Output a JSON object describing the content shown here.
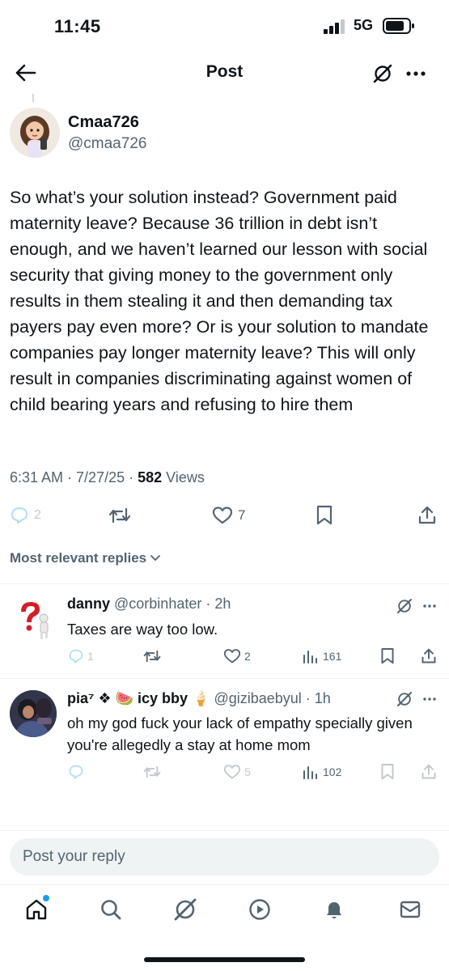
{
  "status_bar": {
    "time": "11:45",
    "network": "5G"
  },
  "header": {
    "title": "Post"
  },
  "post": {
    "author_name": "Cmaa726",
    "author_handle": "@cmaa726",
    "text": "So what’s your solution instead? Government paid maternity leave? Because 36 trillion in debt isn’t enough, and we haven’t learned our lesson with social security that giving money to the government only results in them stealing it and then demanding tax payers pay even more? Or is your solution to mandate companies pay longer maternity leave? This will only result in companies discriminating against women of child bearing years and refusing to hire them",
    "timestamp": "6:31 AM · 7/27/25 · ",
    "views_count": "582",
    "views_label": " Views",
    "reply_count": "2",
    "like_count": "7"
  },
  "replies_sort_label": "Most relevant replies",
  "replies": [
    {
      "name": "danny",
      "handle": " @corbinhater",
      "time": " · 2h",
      "text": "Taxes are way too low.",
      "reply_count": "1",
      "like_count": "2",
      "views": "161"
    },
    {
      "name": "pia⁷ ❖ 🍉 icy bby 🍦",
      "handle": " @gizibaebyul",
      "time": " · 1h",
      "text": "oh my god fuck your lack of empathy specially given you're allegedly a stay at home mom",
      "reply_count": "",
      "like_count": "5",
      "views": "102"
    }
  ],
  "compose": {
    "placeholder": "Post your reply"
  },
  "nav": {
    "items": [
      "home-icon",
      "search-icon",
      "grok-icon",
      "video-icon",
      "notifications-icon",
      "messages-icon"
    ]
  },
  "colors": {
    "text": "#0f1419",
    "secondary": "#536471",
    "accent": "#1d9bf0",
    "divider": "#eff3f4",
    "watermelon_red": "#e0344a"
  }
}
